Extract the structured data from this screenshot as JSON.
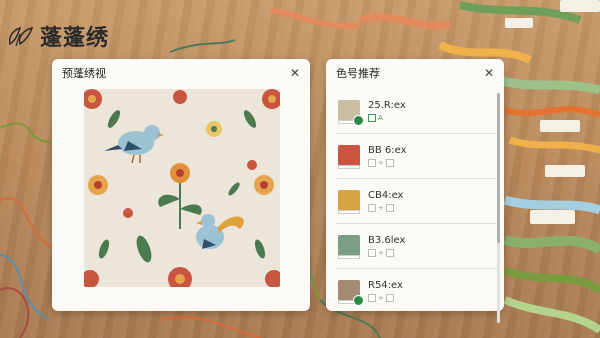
{
  "brand": {
    "name": "蓬蓬绣"
  },
  "preview_panel": {
    "title": "预蓬绣视",
    "close_icon": "close-icon"
  },
  "colors_panel": {
    "title": "色号推荐",
    "close_icon": "close-icon",
    "items": [
      {
        "code": "25.R:ex",
        "color": "#cbbd9f",
        "selected": true,
        "tag": "A"
      },
      {
        "code": "BB 6:ex",
        "color": "#c8553f",
        "selected": false,
        "tag": ""
      },
      {
        "code": "CB4:ex",
        "color": "#d8a546",
        "selected": false,
        "tag": ""
      },
      {
        "code": "B3.6lex",
        "color": "#7c9e88",
        "selected": false,
        "tag": ""
      },
      {
        "code": "R54:ex",
        "color": "#a58a74",
        "selected": true,
        "tag": ""
      }
    ]
  }
}
